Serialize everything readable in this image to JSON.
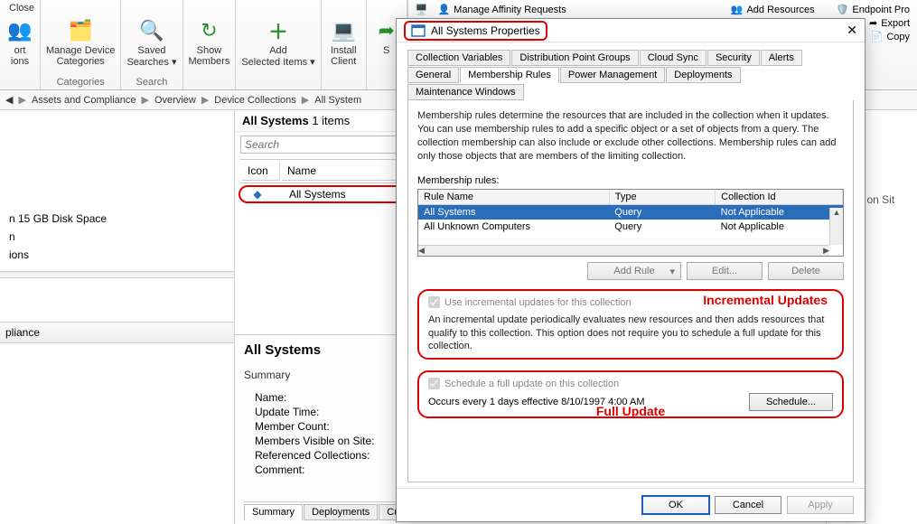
{
  "ribbon": {
    "close": "Close",
    "groups": {
      "ort": {
        "label": "ort",
        "sublabel": "ions"
      },
      "manage_device_categories": "Manage Device\nCategories",
      "categories_label": "Categories",
      "saved_searches": "Saved\nSearches ▾",
      "search_label": "Search",
      "show_members": "Show\nMembers",
      "add_selected_items": "Add\nSelected Items ▾",
      "install_client": "Install\nClient",
      "s_trunc": "S"
    },
    "right": {
      "manage_affinity": "Manage Affinity Requests",
      "add_resources": "Add Resources",
      "endpoint": "Endpoint Pro",
      "export": "Export",
      "copy": "Copy"
    }
  },
  "breadcrumb": {
    "items": [
      "Assets and Compliance",
      "Overview",
      "Device Collections",
      "All System"
    ]
  },
  "left": {
    "tree_item": "n 15 GB Disk Space",
    "tree_item2": "n",
    "tree_item3": "ions",
    "section": "pliance"
  },
  "mid": {
    "header_title": "All Systems",
    "header_count": "1 items",
    "search_placeholder": "Search",
    "col_icon": "Icon",
    "col_name": "Name",
    "row0": {
      "name": "All Systems"
    },
    "detail_title": "All Systems",
    "detail_summary": "Summary",
    "kv": {
      "name": "Name:",
      "update_time": "Update Time:",
      "member_count": "Member Count:",
      "members_visible": "Members Visible on Site:",
      "referenced": "Referenced Collections:",
      "comment": "Comment:"
    },
    "tabs": {
      "summary": "Summary",
      "deployments": "Deployments",
      "cust": "Cust"
    }
  },
  "right_peek": {
    "visible_on_site": "Visible on Sit"
  },
  "dialog": {
    "title": "All Systems Properties",
    "tabs_back": [
      "Collection Variables",
      "Distribution Point Groups",
      "Cloud Sync",
      "Security",
      "Alerts"
    ],
    "tabs_front": [
      "General",
      "Membership Rules",
      "Power Management",
      "Deployments",
      "Maintenance Windows"
    ],
    "active_tab": "Membership Rules",
    "description": "Membership rules determine the resources that are included in the collection when it updates. You can use membership rules to add a specific object or a set of objects from a query. The collection membership can also include or exclude other collections. Membership rules can add only those objects that are members of the limiting collection.",
    "rules_label": "Membership rules:",
    "rule_cols": {
      "name": "Rule Name",
      "type": "Type",
      "collid": "Collection Id"
    },
    "rules": [
      {
        "name": "All Systems",
        "type": "Query",
        "collid": "Not Applicable"
      },
      {
        "name": "All Unknown Computers",
        "type": "Query",
        "collid": "Not Applicable"
      }
    ],
    "btn_addrule": "Add Rule",
    "btn_edit": "Edit...",
    "btn_delete": "Delete",
    "incremental": {
      "checkbox": "Use incremental updates for this collection",
      "desc": "An incremental update periodically evaluates new resources and then adds resources that qualify to this collection. This option does not require you to schedule a full update for this collection.",
      "red_label": "Incremental Updates"
    },
    "full": {
      "checkbox": "Schedule a full update on this collection",
      "occurs": "Occurs every 1 days effective 8/10/1997 4:00 AM",
      "schedule_btn": "Schedule...",
      "red_label": "Full Update"
    },
    "btn_ok": "OK",
    "btn_cancel": "Cancel",
    "btn_apply": "Apply"
  }
}
